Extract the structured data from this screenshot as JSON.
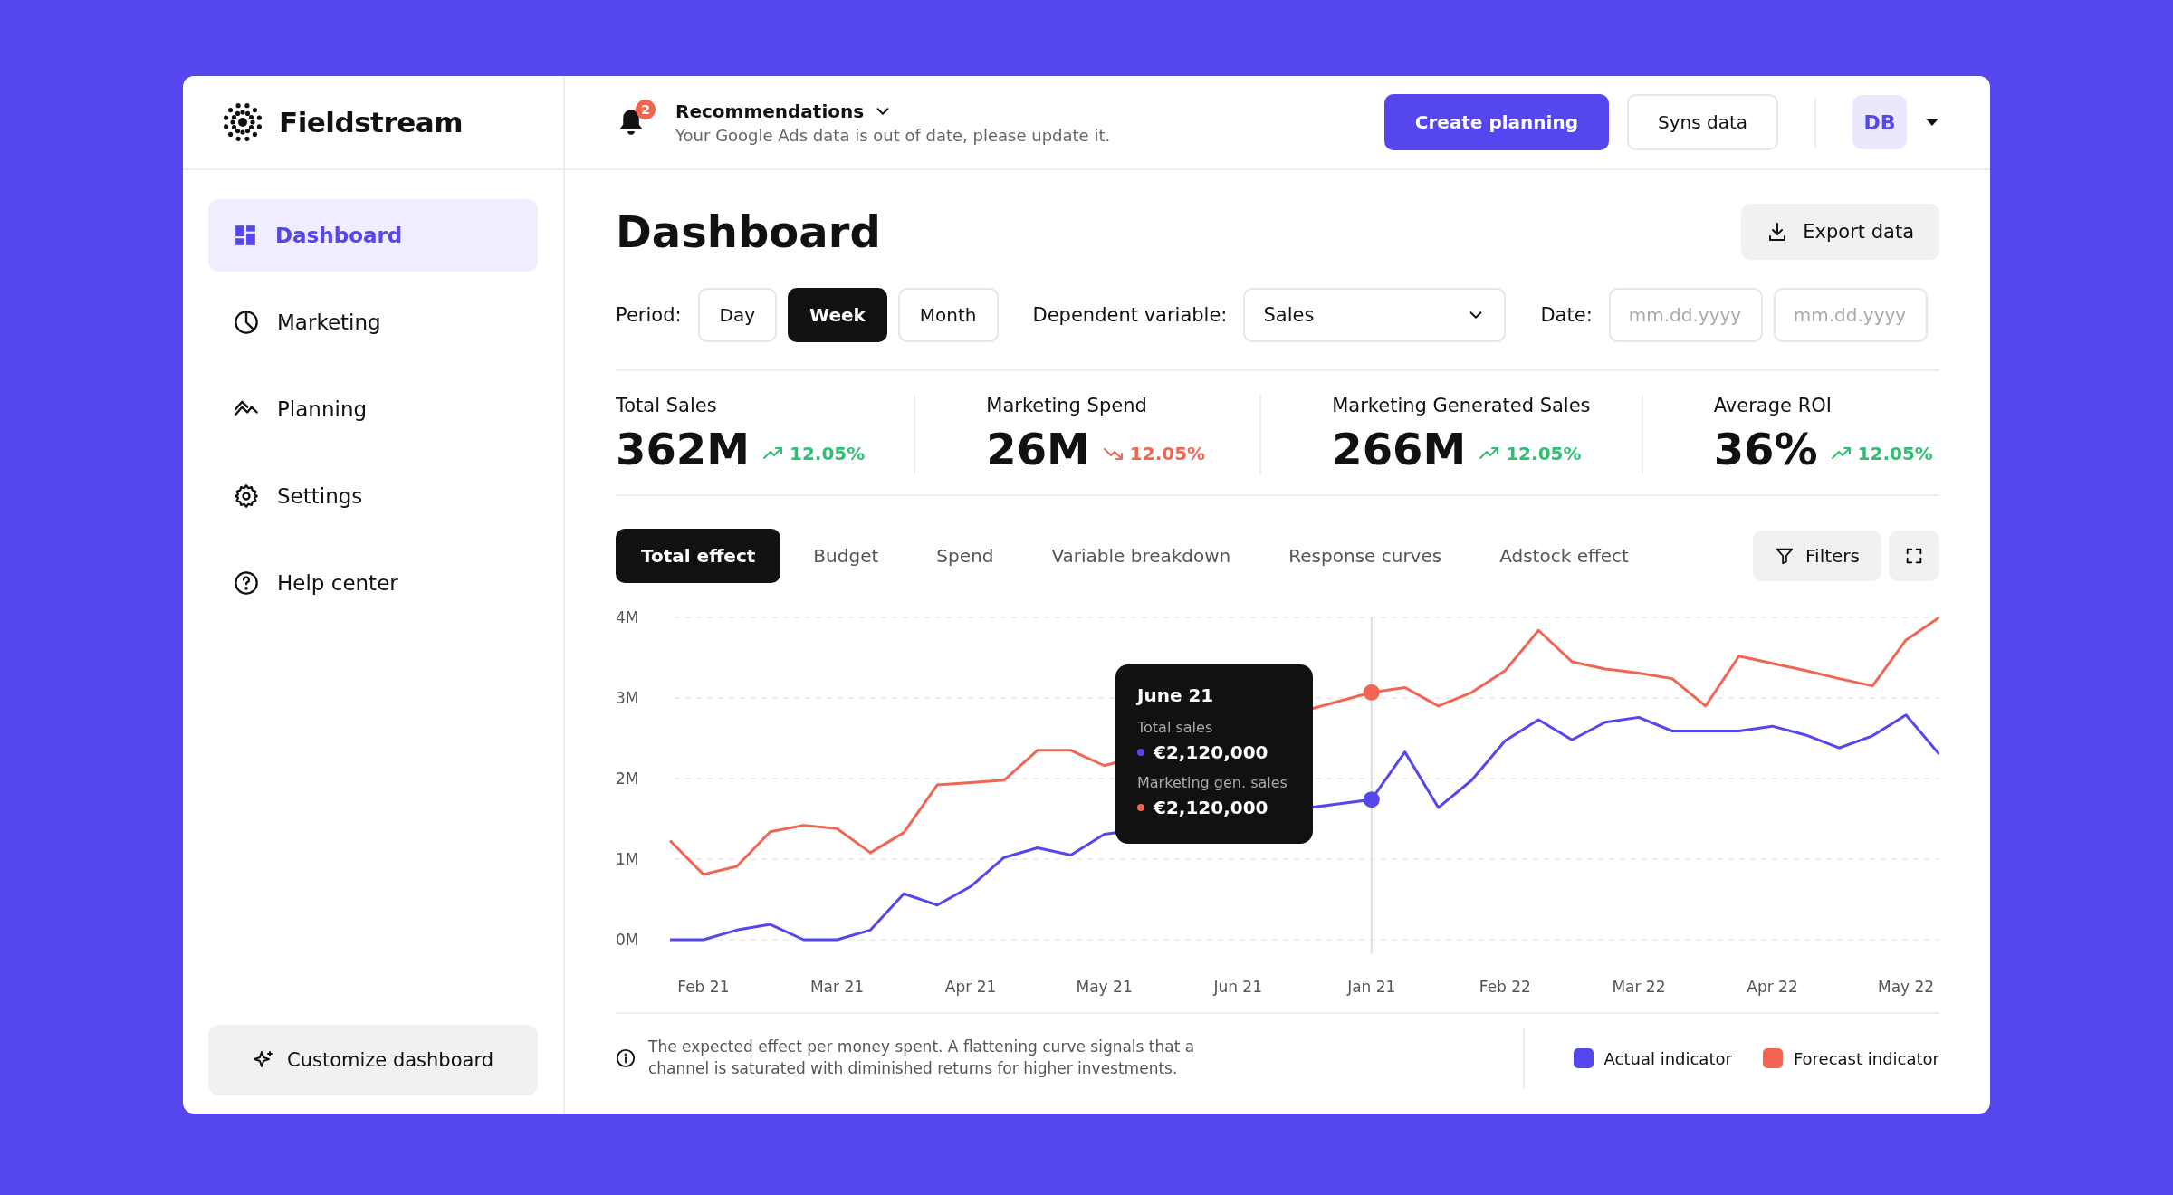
{
  "brand": {
    "name": "Fieldstream"
  },
  "sidebar": {
    "items": [
      {
        "label": "Dashboard",
        "selected": true
      },
      {
        "label": "Marketing",
        "selected": false
      },
      {
        "label": "Planning",
        "selected": false
      },
      {
        "label": "Settings",
        "selected": false
      },
      {
        "label": "Help center",
        "selected": false
      }
    ],
    "customize_button": "Customize dashboard"
  },
  "topbar": {
    "notification_count": "2",
    "title": "Recommendations",
    "message": "Your Google Ads data is out of date, please update it.",
    "primary_button": "Create planning",
    "secondary_button": "Syns data",
    "avatar": "DB"
  },
  "page": {
    "title": "Dashboard",
    "export_button": "Export data"
  },
  "filters": {
    "period_label": "Period:",
    "periods": [
      {
        "label": "Day",
        "selected": false
      },
      {
        "label": "Week",
        "selected": true
      },
      {
        "label": "Month",
        "selected": false
      }
    ],
    "dependent_label": "Dependent variable:",
    "dependent_value": "Sales",
    "date_label": "Date:",
    "date_from": {
      "placeholder": "mm.dd.yyyy"
    },
    "date_to": {
      "placeholder": "mm.dd.yyyy"
    }
  },
  "kpis": [
    {
      "label": "Total Sales",
      "value": "362M",
      "change": "12.05%",
      "positive": true
    },
    {
      "label": "Marketing Spend",
      "value": "26M",
      "change": "12.05%",
      "positive": false
    },
    {
      "label": "Marketing Generated Sales",
      "value": "266M",
      "change": "12.05%",
      "positive": true
    },
    {
      "label": "Average ROI",
      "value": "36%",
      "change": "12.05%",
      "positive": true
    }
  ],
  "chart_tabs": [
    {
      "label": "Total effect",
      "selected": true
    },
    {
      "label": "Budget",
      "selected": false
    },
    {
      "label": "Spend",
      "selected": false
    },
    {
      "label": "Variable breakdown",
      "selected": false
    },
    {
      "label": "Response curves",
      "selected": false
    },
    {
      "label": "Adstock effect",
      "selected": false
    }
  ],
  "filters_button": "Filters",
  "chart": {
    "tooltip": {
      "title": "June 21",
      "rows": [
        {
          "label": "Total sales",
          "value": "€2,120,000",
          "color": "#5546ee"
        },
        {
          "label": "Marketing gen. sales",
          "value": "€2,120,000",
          "color": "#f26552"
        }
      ]
    },
    "chart_data": {
      "type": "line",
      "ylim": [
        0,
        4
      ],
      "yticks": [
        {
          "value": 0,
          "label": "0M"
        },
        {
          "value": 1,
          "label": "1M"
        },
        {
          "value": 2,
          "label": "2M"
        },
        {
          "value": 3,
          "label": "3M"
        },
        {
          "value": 4,
          "label": "4M"
        }
      ],
      "categories": [
        null,
        "Feb 21",
        null,
        null,
        null,
        "Mar 21",
        null,
        null,
        null,
        "Apr 21",
        null,
        null,
        null,
        "May 21",
        null,
        null,
        null,
        "Jun 21",
        null,
        null,
        null,
        "Jan 21",
        null,
        null,
        null,
        "Feb 22",
        null,
        null,
        null,
        "Mar 22",
        null,
        null,
        null,
        "Apr 22",
        null,
        null,
        null,
        "May 22",
        null
      ],
      "series": [
        {
          "name": "Actual indicator",
          "color": "#5546ee",
          "values": [
            0,
            0,
            0.12,
            0.19,
            0,
            0,
            0.12,
            0.57,
            0.43,
            0.66,
            1.02,
            1.14,
            1.05,
            1.31,
            null,
            null,
            null,
            null,
            null,
            null,
            null,
            1.74,
            2.33,
            1.64,
            1.98,
            2.47,
            2.73,
            2.48,
            2.7,
            2.76,
            2.59,
            2.59,
            2.59,
            2.65,
            2.54,
            2.38,
            2.53,
            2.79,
            2.3
          ]
        },
        {
          "name": "Forecast indicator",
          "color": "#f26552",
          "values": [
            1.23,
            0.81,
            0.91,
            1.34,
            1.42,
            1.38,
            1.08,
            1.33,
            1.92,
            1.95,
            1.98,
            2.35,
            2.35,
            2.16,
            null,
            null,
            null,
            null,
            null,
            null,
            null,
            3.07,
            3.13,
            2.9,
            3.07,
            3.34,
            3.84,
            3.45,
            3.36,
            3.31,
            3.24,
            2.9,
            3.52,
            3.43,
            3.34,
            3.24,
            3.15,
            3.72,
            4.0
          ]
        }
      ],
      "grid": true
    }
  },
  "footer": {
    "note": "The expected effect per money spent. A flattening curve signals that a channel is saturated with diminished returns for higher investments."
  }
}
